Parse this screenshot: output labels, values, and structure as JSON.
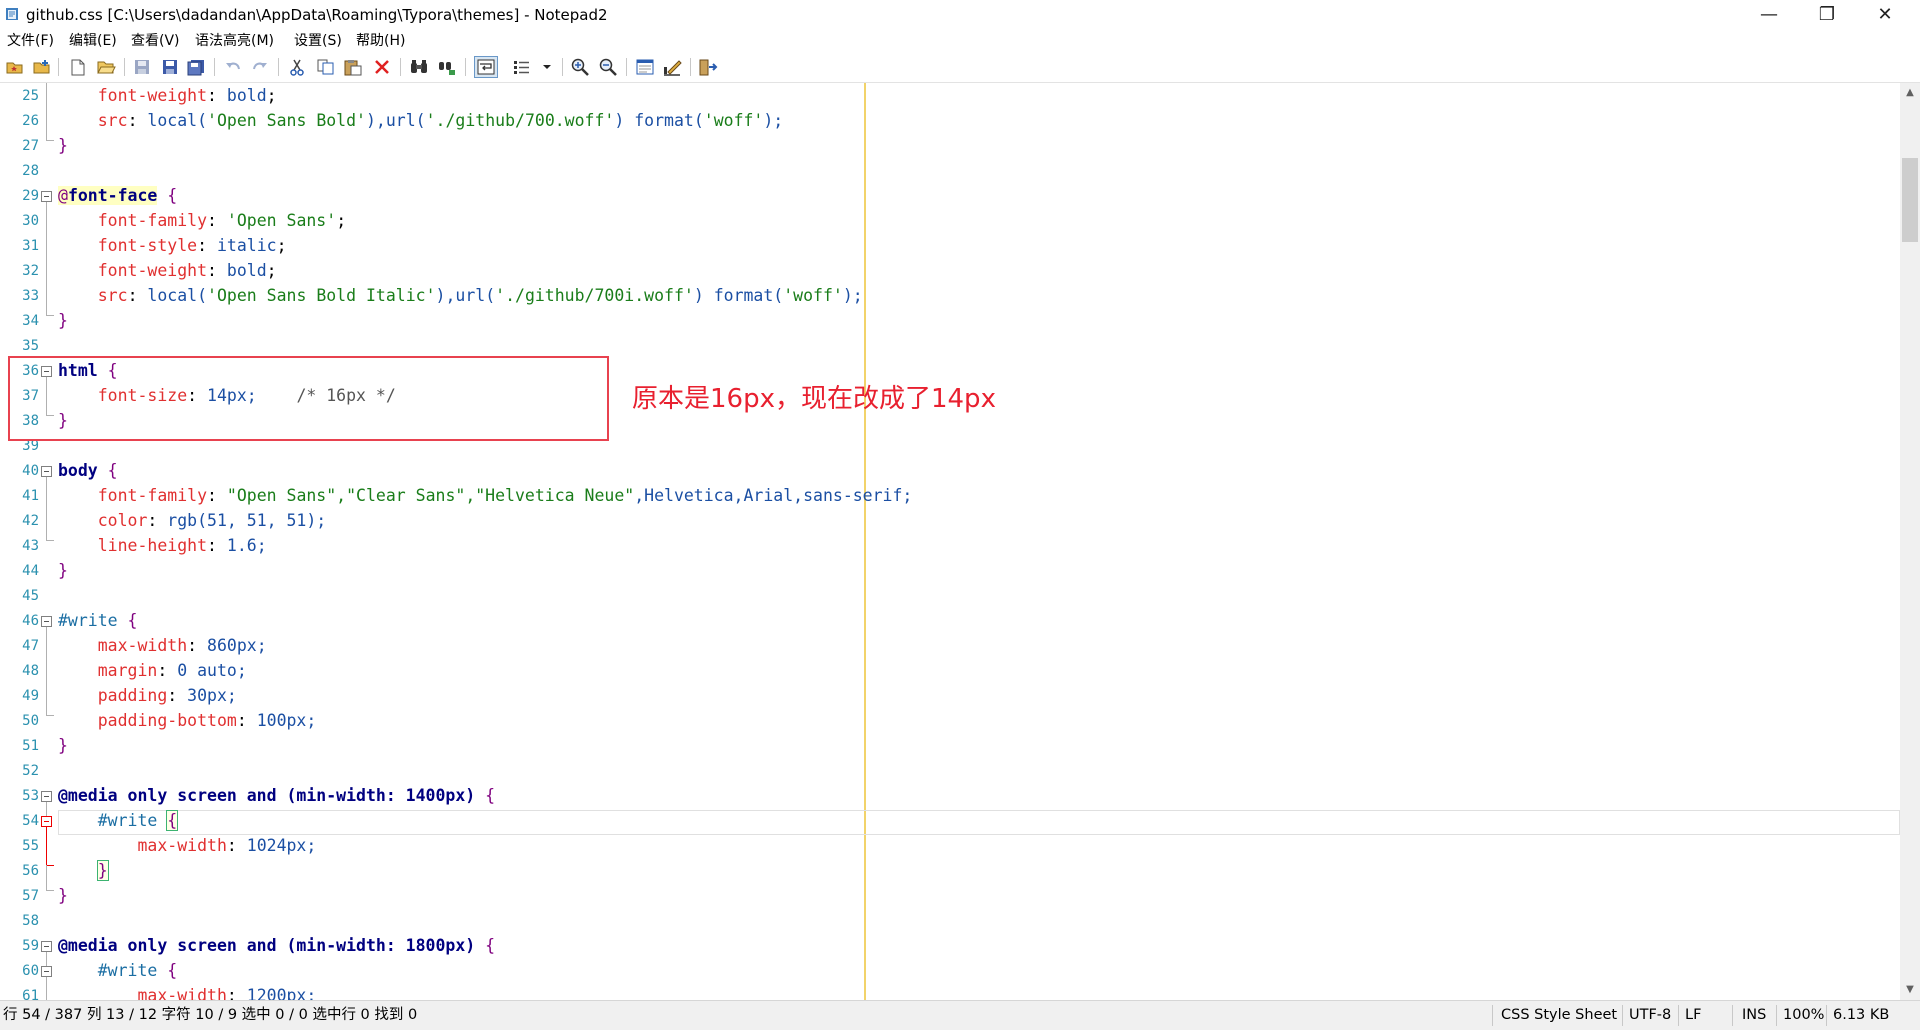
{
  "window": {
    "title": "github.css [C:\\Users\\dadandan\\AppData\\Roaming\\Typora\\themes] - Notepad2",
    "min_glyph": "—",
    "max_glyph": "❐",
    "close_glyph": "✕"
  },
  "menu": [
    "文件(F)",
    "编辑(E)",
    "查看(V)",
    "语法高亮(M)",
    "设置(S)",
    "帮助(H)"
  ],
  "toolbar_icons": [
    "open-favorites-icon",
    "add-favorite-icon",
    "new-file-icon",
    "open-file-icon",
    "save-disabled-icon",
    "save-icon",
    "save-as-icon",
    "save-copy-icon",
    "undo-icon",
    "redo-icon",
    "cut-icon",
    "copy-icon",
    "paste-icon",
    "delete-icon",
    "find-icon",
    "replace-icon",
    "word-wrap-icon",
    "bullet-list-icon",
    "dropdown-icon",
    "zoom-in-icon",
    "zoom-out-icon",
    "view-schemes-icon",
    "customize-schemes-icon",
    "exit-icon"
  ],
  "gutter": {
    "line_numbers": [
      "25",
      "26",
      "27",
      "28",
      "29",
      "30",
      "31",
      "32",
      "33",
      "34",
      "35",
      "36",
      "37",
      "38",
      "39",
      "40",
      "41",
      "42",
      "43",
      "44",
      "45",
      "46",
      "47",
      "48",
      "49",
      "50",
      "51",
      "52",
      "53",
      "54",
      "55",
      "56",
      "57",
      "58",
      "59",
      "60",
      "61"
    ]
  },
  "code": {
    "l25": {
      "prop": "font-weight",
      "val": " bold"
    },
    "l26": {
      "prop": "src",
      "val1": " local(",
      "str1": "'Open Sans Bold'",
      "val2": "),url(",
      "str2": "'./github/700.woff'",
      "val3": ") format(",
      "str3": "'woff'",
      "val4": ");"
    },
    "l29": {
      "at": "@",
      "sel": "font-face",
      "punc": " {"
    },
    "l30": {
      "prop": "font-family",
      "str": "'Open Sans'"
    },
    "l31": {
      "prop": "font-style",
      "val": " italic"
    },
    "l32": {
      "prop": "font-weight",
      "val": " bold"
    },
    "l33": {
      "prop": "src",
      "val1": " local(",
      "str1": "'Open Sans Bold Italic'",
      "val2": "),url(",
      "str2": "'./github/700i.woff'",
      "val3": ") format(",
      "str3": "'woff'",
      "val4": ");"
    },
    "l36": {
      "sel": "html",
      "punc": " {"
    },
    "l37": {
      "prop": "font-size",
      "val": " 14px;",
      "cmt": "    /* 16px */"
    },
    "l40": {
      "sel": "body",
      "punc": " {"
    },
    "l41": {
      "prop": "font-family",
      "str": "\"Open Sans\",\"Clear Sans\",\"Helvetica Neue\"",
      "val": ",Helvetica,Arial,sans-serif;"
    },
    "l42": {
      "prop": "color",
      "val": " rgb(51, 51, 51);"
    },
    "l43": {
      "prop": "line-height",
      "val": " 1.6;"
    },
    "l46": {
      "id": "#write",
      "punc": " {"
    },
    "l47": {
      "prop": "max-width",
      "val": " 860px;"
    },
    "l48": {
      "prop": "margin",
      "val": " 0 auto;"
    },
    "l49": {
      "prop": "padding",
      "val": " 30px;"
    },
    "l50": {
      "prop": "padding-bottom",
      "val": " 100px;"
    },
    "l53": {
      "text": "@media only screen and (min-width: 1400px)",
      "punc": " {"
    },
    "l54": {
      "id": "#write",
      "punc": "{"
    },
    "l55": {
      "prop": "max-width",
      "val": " 1024px;"
    },
    "l59": {
      "text": "@media only screen and (min-width: 1800px)",
      "punc": " {"
    },
    "l60": {
      "id": "#write",
      "punc": " {"
    },
    "l61": {
      "prop": "max-width",
      "val": " 1200px;"
    },
    "colon": ":",
    "semi": ";",
    "close_brace": "}"
  },
  "annotation": {
    "text": "原本是16px，现在改成了14px",
    "color": "#e8202f"
  },
  "status": {
    "position": "行 54 / 387  列 13 / 12  字符 10 / 9  选中 0 / 0  选中行 0  找到 0",
    "scheme": "CSS Style Sheet",
    "encoding": "UTF-8",
    "eol": "LF",
    "ins": "INS",
    "zoom": "100%",
    "size": "6.13 KB"
  },
  "colors": {
    "line_number": "#2b91af",
    "property": "#e03030",
    "value": "#1b4fa3",
    "string": "#1a7d1a",
    "selector": "#000080",
    "annotation_box": "#e8424f",
    "long_line": "#f2d36a"
  }
}
